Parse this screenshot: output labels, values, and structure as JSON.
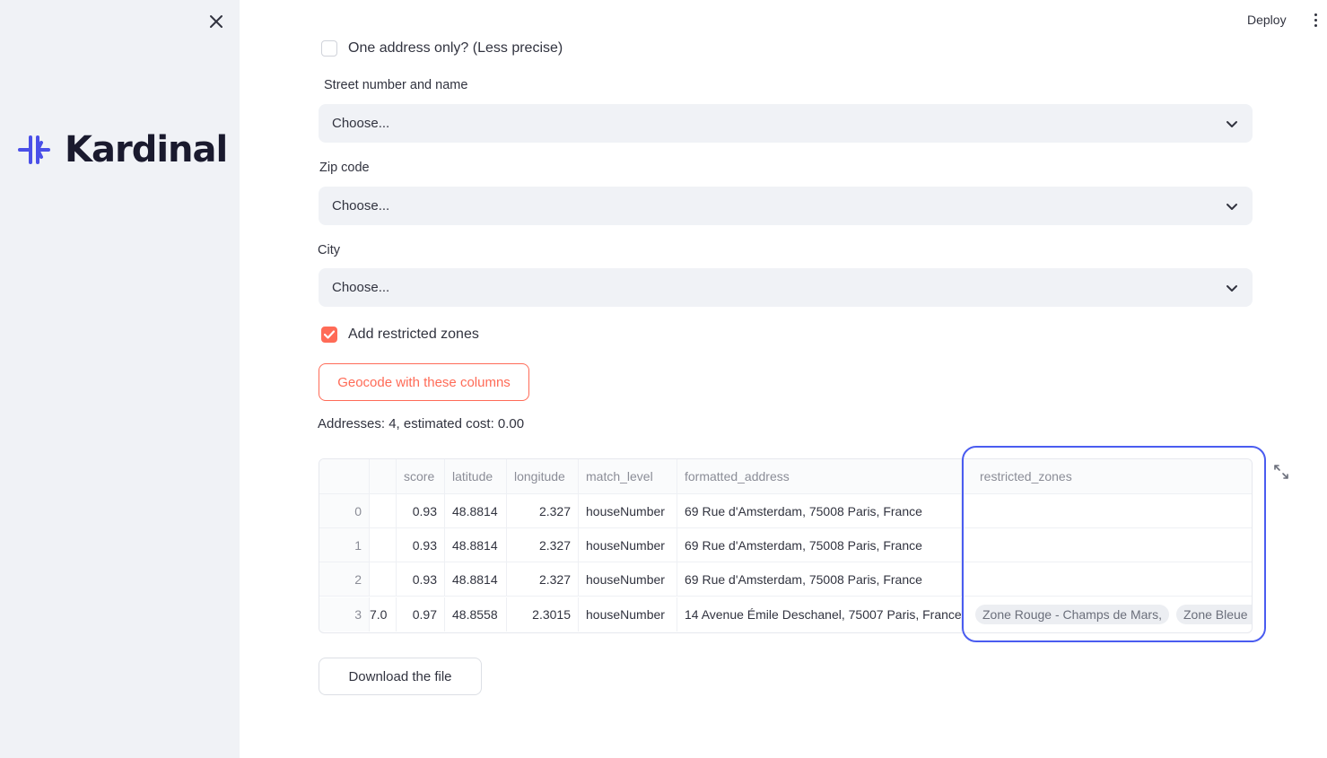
{
  "sidebar": {
    "brand": "Kardinal",
    "brand_color": "#4a4fe8"
  },
  "header": {
    "deploy_label": "Deploy"
  },
  "form": {
    "one_address": {
      "label": "One address only? (Less precise)",
      "checked": false
    },
    "street": {
      "label": "Street number and name",
      "value": "Choose..."
    },
    "zip": {
      "label": "Zip code",
      "value": "Choose..."
    },
    "city": {
      "label": "City",
      "value": "Choose..."
    },
    "restricted": {
      "label": "Add restricted zones",
      "checked": true
    },
    "geocode_label": "Geocode with these columns",
    "summary": "Addresses: 4, estimated cost: 0.00"
  },
  "table": {
    "columns": [
      "",
      "",
      "score",
      "latitude",
      "longitude",
      "match_level",
      "formatted_address",
      "restricted_zones"
    ],
    "rows": [
      {
        "index": "0",
        "hidden": "",
        "score": "0.93",
        "latitude": "48.8814",
        "longitude": "2.327",
        "match_level": "houseNumber",
        "formatted_address": "69 Rue d'Amsterdam, 75008 Paris, France",
        "zones": []
      },
      {
        "index": "1",
        "hidden": "",
        "score": "0.93",
        "latitude": "48.8814",
        "longitude": "2.327",
        "match_level": "houseNumber",
        "formatted_address": "69 Rue d'Amsterdam, 75008 Paris, France",
        "zones": []
      },
      {
        "index": "2",
        "hidden": "",
        "score": "0.93",
        "latitude": "48.8814",
        "longitude": "2.327",
        "match_level": "houseNumber",
        "formatted_address": "69 Rue d'Amsterdam, 75008 Paris, France",
        "zones": []
      },
      {
        "index": "3",
        "hidden": "7.0",
        "score": "0.97",
        "latitude": "48.8558",
        "longitude": "2.3015",
        "match_level": "houseNumber",
        "formatted_address": "14 Avenue Émile Deschanel, 75007 Paris, France",
        "zones": [
          "Zone Rouge - Champs de Mars,",
          "Zone Bleue -"
        ]
      }
    ]
  },
  "download_label": "Download the file",
  "colors": {
    "accent": "#ff6b57",
    "highlight": "#4a5cf0"
  }
}
